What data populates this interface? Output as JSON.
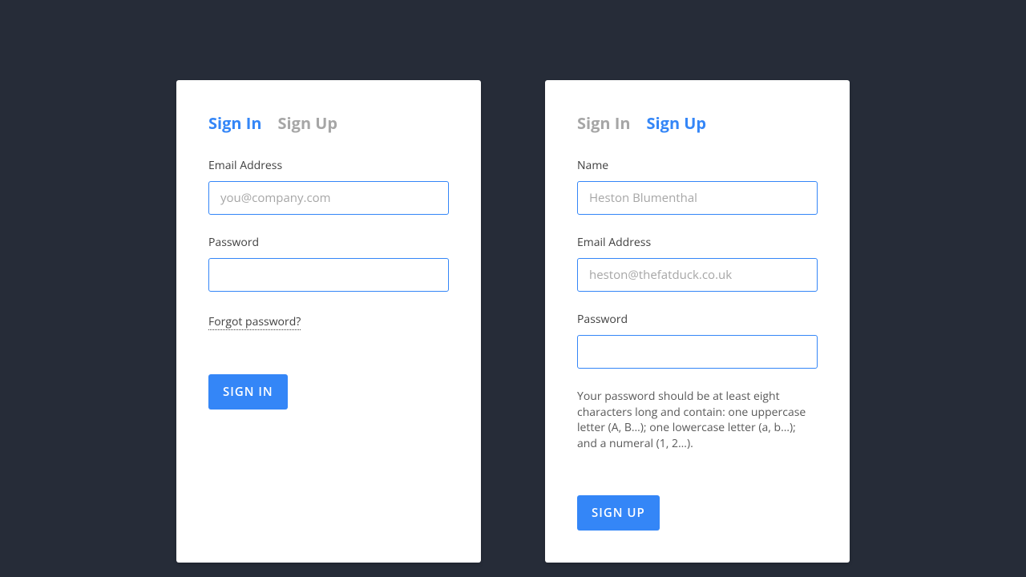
{
  "signin": {
    "tabs": {
      "signin": "Sign In",
      "signup": "Sign Up"
    },
    "email": {
      "label": "Email Address",
      "placeholder": "you@company.com"
    },
    "password": {
      "label": "Password"
    },
    "forgot": "Forgot password?",
    "submit": "Sign In"
  },
  "signup": {
    "tabs": {
      "signin": "Sign In",
      "signup": "Sign Up"
    },
    "name": {
      "label": "Name",
      "placeholder": "Heston Blumenthal"
    },
    "email": {
      "label": "Email Address",
      "placeholder": "heston@thefatduck.co.uk"
    },
    "password": {
      "label": "Password",
      "help": "Your password should be at least eight characters long and contain: one uppercase letter (A, B…); one lowercase letter (a, b…); and a numeral (1, 2…)."
    },
    "submit": "Sign Up"
  }
}
